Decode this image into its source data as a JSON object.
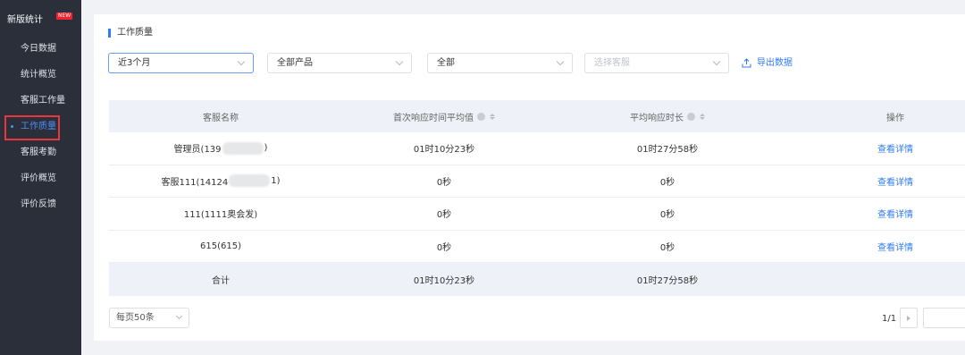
{
  "sidebar": {
    "title": "新版统计",
    "badge": "NEW",
    "items": [
      {
        "label": "今日数据"
      },
      {
        "label": "统计概览"
      },
      {
        "label": "客服工作量"
      },
      {
        "label": "工作质量"
      },
      {
        "label": "客服考勤"
      },
      {
        "label": "评价概览"
      },
      {
        "label": "评价反馈"
      }
    ]
  },
  "section": {
    "title": "工作质量"
  },
  "filters": {
    "period": "近3个月",
    "product": "全部产品",
    "scope": "全部",
    "agent_placeholder": "选择客服"
  },
  "export_label": "导出数据",
  "table": {
    "headers": [
      "客服名称",
      "首次响应时间平均值",
      "平均响应时长",
      "操作"
    ],
    "rows": [
      {
        "name_pre": "管理员(139",
        "name_post": ")",
        "first": "01时10分23秒",
        "avg": "01时27分58秒",
        "action": "查看详情"
      },
      {
        "name_pre": "客服111(14124",
        "name_post": "1)",
        "first": "0秒",
        "avg": "0秒",
        "action": "查看详情"
      },
      {
        "name": "111(1111奥会发)",
        "first": "0秒",
        "avg": "0秒",
        "action": "查看详情"
      },
      {
        "name": "615(615)",
        "first": "0秒",
        "avg": "0秒",
        "action": "查看详情"
      }
    ],
    "total": {
      "label": "合计",
      "first": "01时10分23秒",
      "avg": "01时27分58秒"
    }
  },
  "pagination": {
    "page_size": "每页50条",
    "page_info": "1/1"
  },
  "colors": {
    "accent": "#2f7bf0",
    "sidebar_bg": "#2b2f3a",
    "highlight": "#e5373d"
  }
}
